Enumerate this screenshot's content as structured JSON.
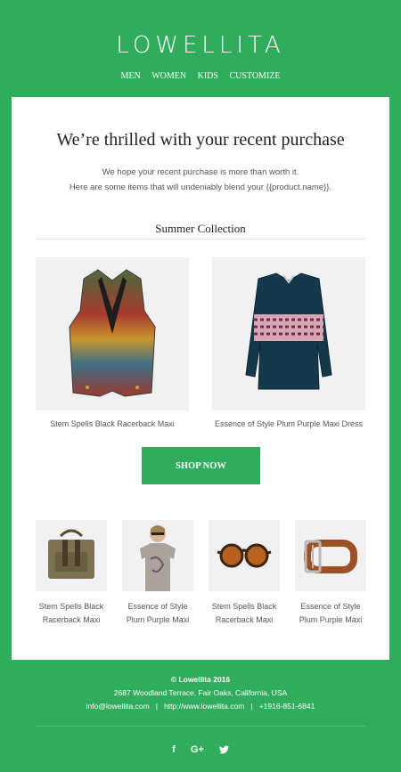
{
  "header": {
    "brand": "LOWELLITA",
    "nav": [
      "MEN",
      "WOMEN",
      "KIDS",
      "CUSTOMIZE"
    ]
  },
  "main": {
    "headline": "We’re thrilled with your recent purchase",
    "intro_line1": "We hope your recent purchase is more than worth it.",
    "intro_line2": "Here are some items that will undeniably blend your {{product.name}}.",
    "section_title": "Summer Collection",
    "featured": [
      {
        "caption": "Stem Spells Black Racerback Maxi",
        "icon": "vest-icon"
      },
      {
        "caption": "Essence of Style Plum Purple Maxi Dress",
        "icon": "dress-icon"
      }
    ],
    "shop_button": "SHOP NOW",
    "grid": [
      {
        "caption_line1": "Stem Spells Black",
        "caption_line2": "Racerback Maxi",
        "icon": "bag-icon"
      },
      {
        "caption_line1": "Essence of Style",
        "caption_line2": "Plum Purple Maxi",
        "icon": "tshirt-icon"
      },
      {
        "caption_line1": "Stem Spells Black",
        "caption_line2": "Racerback Maxi",
        "icon": "sunglasses-icon"
      },
      {
        "caption_line1": "Essence of Style",
        "caption_line2": "Plum Purple Maxi",
        "icon": "belt-icon"
      }
    ]
  },
  "footer": {
    "copyright": "© Lowellita 2016",
    "address": "2687 Woodland Terrace, Fair Oaks, California, USA",
    "email": "info@lowellita.com",
    "website": "http://www.lowellita.com",
    "phone": "+1916-851-6841",
    "separator": "|",
    "social": [
      "f",
      "G+",
      "twitter"
    ]
  },
  "colors": {
    "brand_green": "#2fad5d",
    "card_bg": "#ffffff",
    "tile_bg": "#f1f1f2"
  }
}
